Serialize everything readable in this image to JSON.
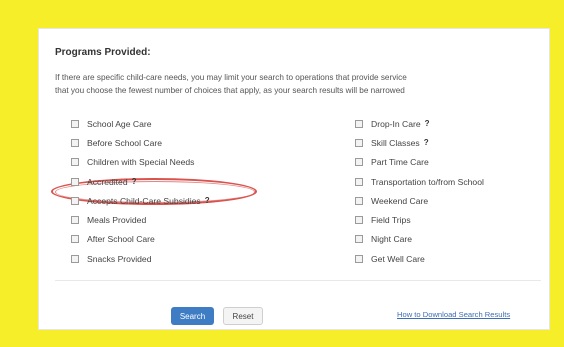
{
  "colors": {
    "frame": "#f7ee2a",
    "highlight": "#d9534f",
    "primary_button": "#3e7cc4",
    "link": "#3e6db5"
  },
  "programs": {
    "title": "Programs Provided:",
    "description_line1": "If there are specific child-care needs, you may limit your search to operations that provide service",
    "description_line2": "that you choose the fewest number of choices that apply, as your search results will be narrowed",
    "help_glyph": "?",
    "left_options": [
      {
        "label": "School Age Care",
        "checked": false
      },
      {
        "label": "Before School Care",
        "checked": false
      },
      {
        "label": "Children with Special Needs",
        "checked": false
      },
      {
        "label": "Accredited",
        "checked": false,
        "help": true
      },
      {
        "label": "Accepts Child-Care Subsidies",
        "checked": false,
        "help": true,
        "highlighted": true
      },
      {
        "label": "Meals Provided",
        "checked": false
      },
      {
        "label": "After School Care",
        "checked": false
      },
      {
        "label": "Snacks Provided",
        "checked": false
      }
    ],
    "right_options": [
      {
        "label": "Drop-In Care",
        "checked": false,
        "help": true
      },
      {
        "label": "Skill Classes",
        "checked": false,
        "help": true
      },
      {
        "label": "Part Time Care",
        "checked": false
      },
      {
        "label": "Transportation to/from School",
        "checked": false
      },
      {
        "label": "Weekend Care",
        "checked": false
      },
      {
        "label": "Field Trips",
        "checked": false
      },
      {
        "label": "Night Care",
        "checked": false
      },
      {
        "label": "Get Well Care",
        "checked": false
      }
    ]
  },
  "actions": {
    "search_label": "Search",
    "reset_label": "Reset",
    "download_link_label": "How to Download Search Results"
  }
}
